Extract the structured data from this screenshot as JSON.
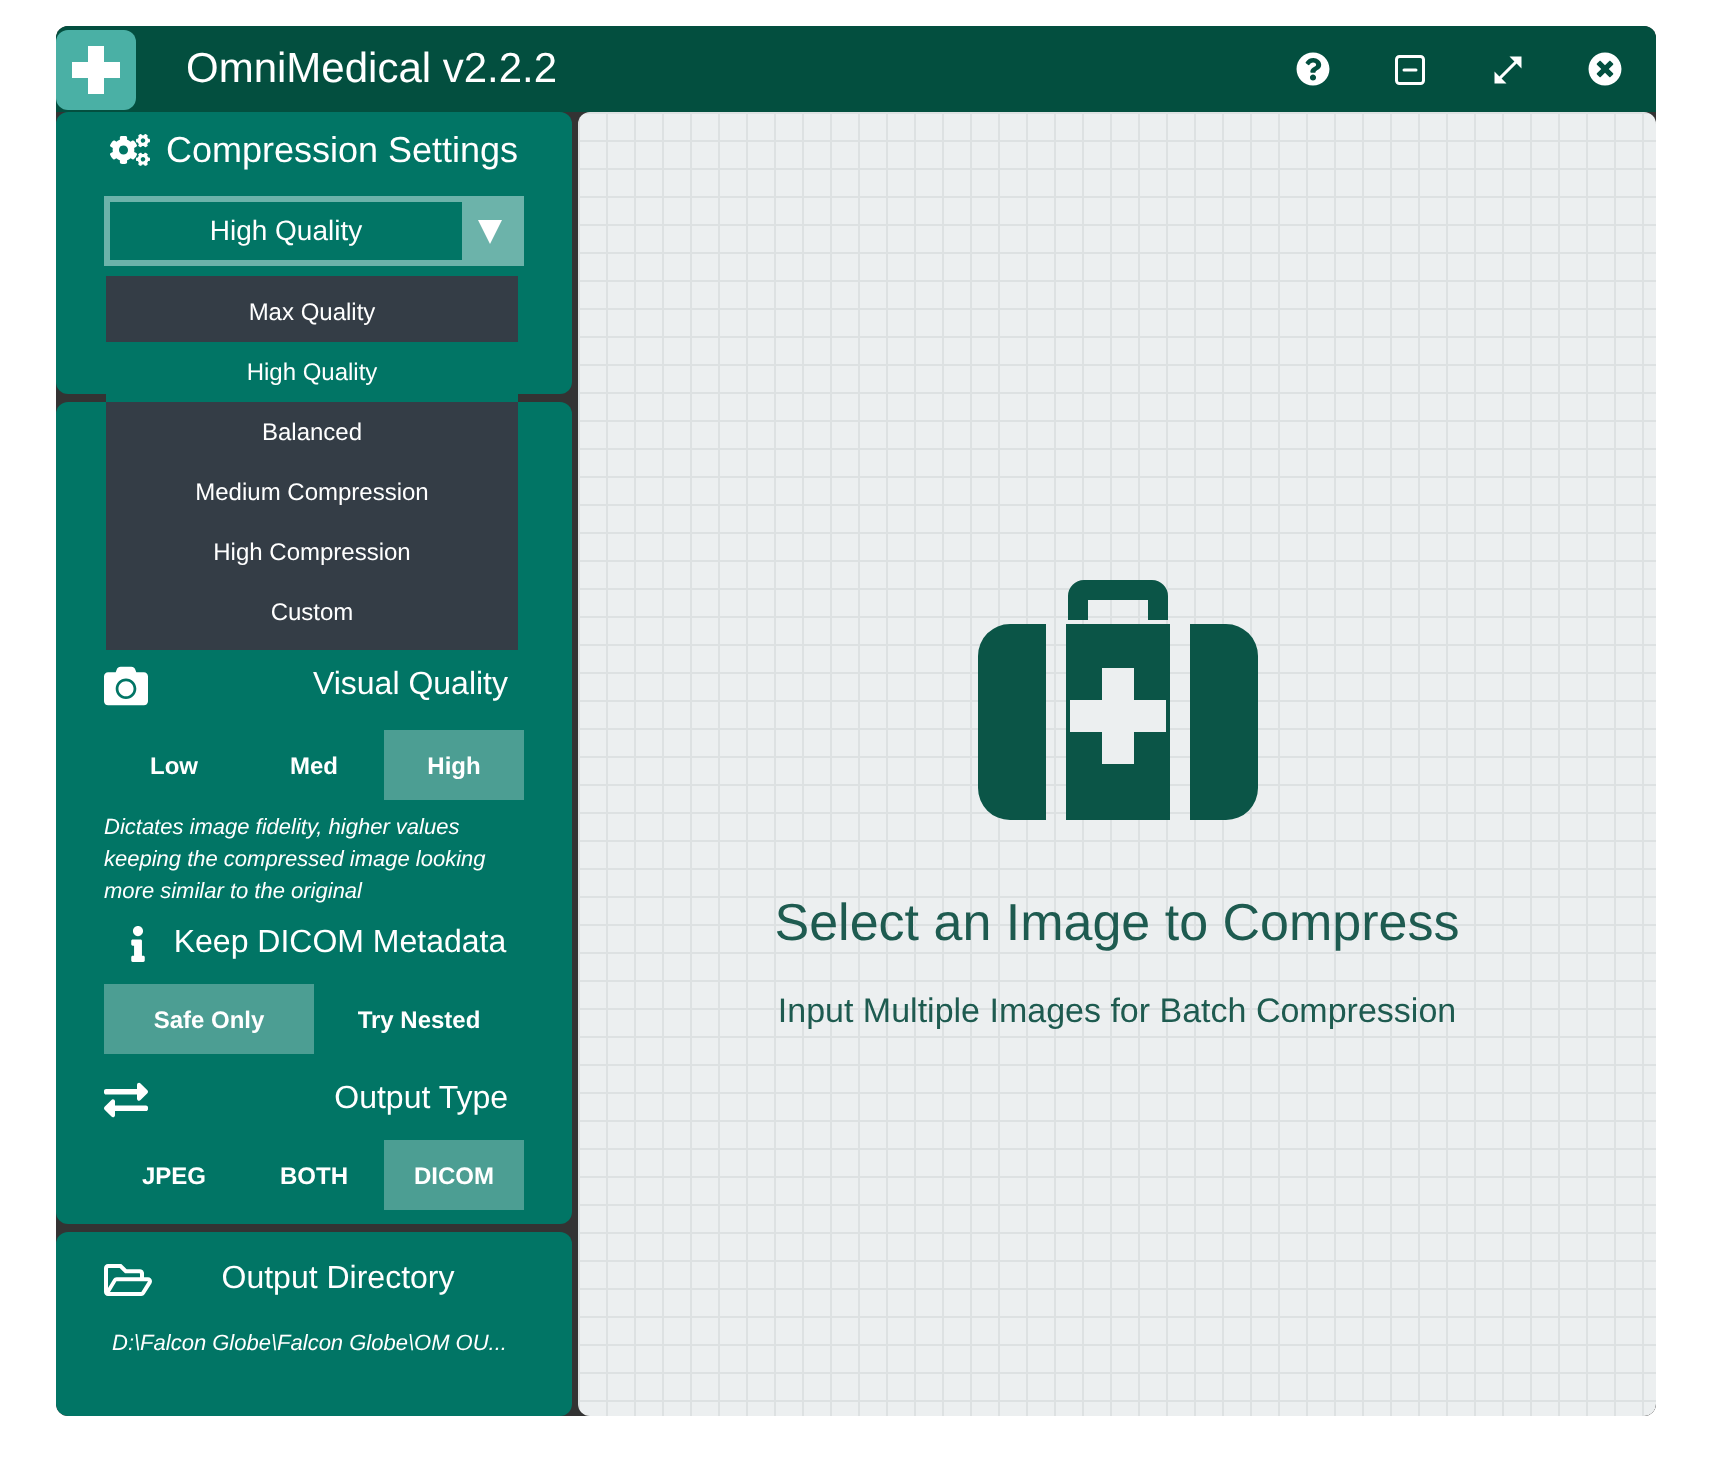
{
  "window": {
    "title": "OmniMedical v2.2.2"
  },
  "compression": {
    "title": "Compression Settings",
    "preset": "High Quality",
    "menu": [
      {
        "label": "Max Quality",
        "selected": false
      },
      {
        "label": "High Quality",
        "selected": true
      },
      {
        "label": "Balanced",
        "selected": false
      },
      {
        "label": "Medium Compression",
        "selected": false
      },
      {
        "label": "High Compression",
        "selected": false
      },
      {
        "label": "Custom",
        "selected": false
      }
    ]
  },
  "visual_quality": {
    "title": "Visual Quality",
    "options": [
      {
        "label": "Low",
        "selected": false
      },
      {
        "label": "Med",
        "selected": false
      },
      {
        "label": "High",
        "selected": true
      }
    ],
    "description": "Dictates image fidelity, higher values keeping the compressed image looking more similar to the original"
  },
  "metadata": {
    "title": "Keep DICOM Metadata",
    "options": [
      {
        "label": "Safe Only",
        "selected": true
      },
      {
        "label": "Try Nested",
        "selected": false
      }
    ]
  },
  "output_type": {
    "title": "Output Type",
    "options": [
      {
        "label": "JPEG",
        "selected": false
      },
      {
        "label": "BOTH",
        "selected": false
      },
      {
        "label": "DICOM",
        "selected": true
      }
    ]
  },
  "output_directory": {
    "title": "Output Directory",
    "path": "D:\\Falcon Globe\\Falcon Globe\\OM OU..."
  },
  "main": {
    "heading": "Select an Image to Compress",
    "subheading": "Input Multiple Images for Batch Compression"
  }
}
